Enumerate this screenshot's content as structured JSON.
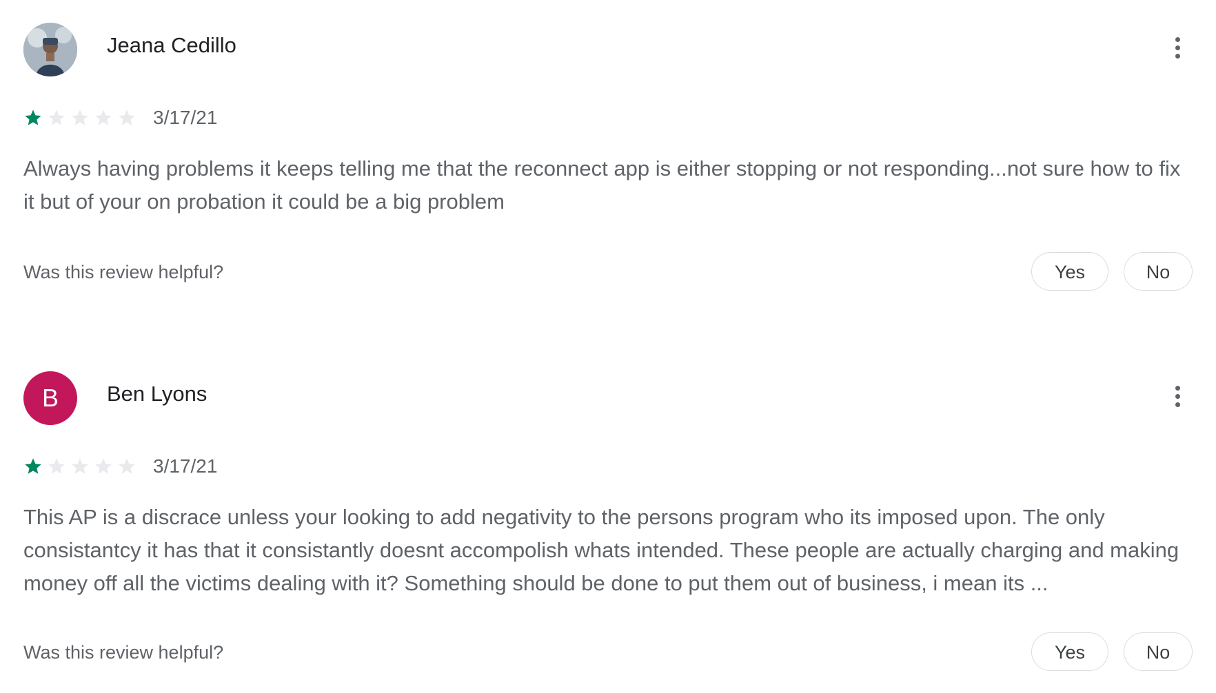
{
  "reviews": [
    {
      "author": "Jeana Cedillo",
      "avatar_type": "photo",
      "rating": 1,
      "max_rating": 5,
      "date": "3/17/21",
      "text": "Always having problems it keeps telling me that the reconnect app is either stopping or not responding...not sure how to fix it but of your on probation it could be a big problem",
      "helpful_question": "Was this review helpful?",
      "yes_label": "Yes",
      "no_label": "No"
    },
    {
      "author": "Ben Lyons",
      "avatar_type": "letter",
      "avatar_letter": "B",
      "avatar_color": "#c2185b",
      "rating": 1,
      "max_rating": 5,
      "date": "3/17/21",
      "text": "This AP is a discrace unless your looking to add negativity to the persons program who its imposed upon. The only consistantcy it has that it consistantly doesnt accompolish whats intended. These people are actually charging and making money off all the victims dealing with it? Something should be done to put them out of business, i mean its ...",
      "helpful_question": "Was this review helpful?",
      "yes_label": "Yes",
      "no_label": "No"
    }
  ],
  "colors": {
    "star_filled": "#01875f",
    "star_empty": "#e8eaed",
    "text_secondary": "#5f6368"
  },
  "icons": {
    "star": "star-icon",
    "more": "more-vert-icon"
  }
}
